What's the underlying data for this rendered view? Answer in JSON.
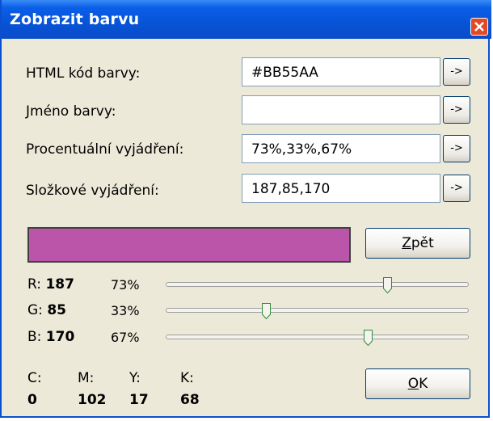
{
  "window": {
    "title": "Zobrazit barvu"
  },
  "rows": [
    {
      "label": "HTML kód barvy:",
      "value": "#BB55AA",
      "button": "->"
    },
    {
      "label": "Jméno barvy:",
      "value": "",
      "button": "->"
    },
    {
      "label": "Procentuální vyjádření:",
      "value": "73%,33%,67%",
      "button": "->"
    },
    {
      "label": "Složkové vyjádření:",
      "value": "187,85,170",
      "button": "->"
    }
  ],
  "preview": {
    "color": "#BB55AA"
  },
  "buttons": {
    "back": "Zpět",
    "ok": "OK"
  },
  "channels": [
    {
      "label": "R:",
      "value": "187",
      "percent": "73%",
      "level": 0.733
    },
    {
      "label": "G:",
      "value": "85",
      "percent": "33%",
      "level": 0.333
    },
    {
      "label": "B:",
      "value": "170",
      "percent": "67%",
      "level": 0.667
    }
  ],
  "cmyk": {
    "c": {
      "label": "C:",
      "value": "0"
    },
    "m": {
      "label": "M:",
      "value": "102"
    },
    "y": {
      "label": "Y:",
      "value": "17"
    },
    "k": {
      "label": "K:",
      "value": "68"
    }
  }
}
